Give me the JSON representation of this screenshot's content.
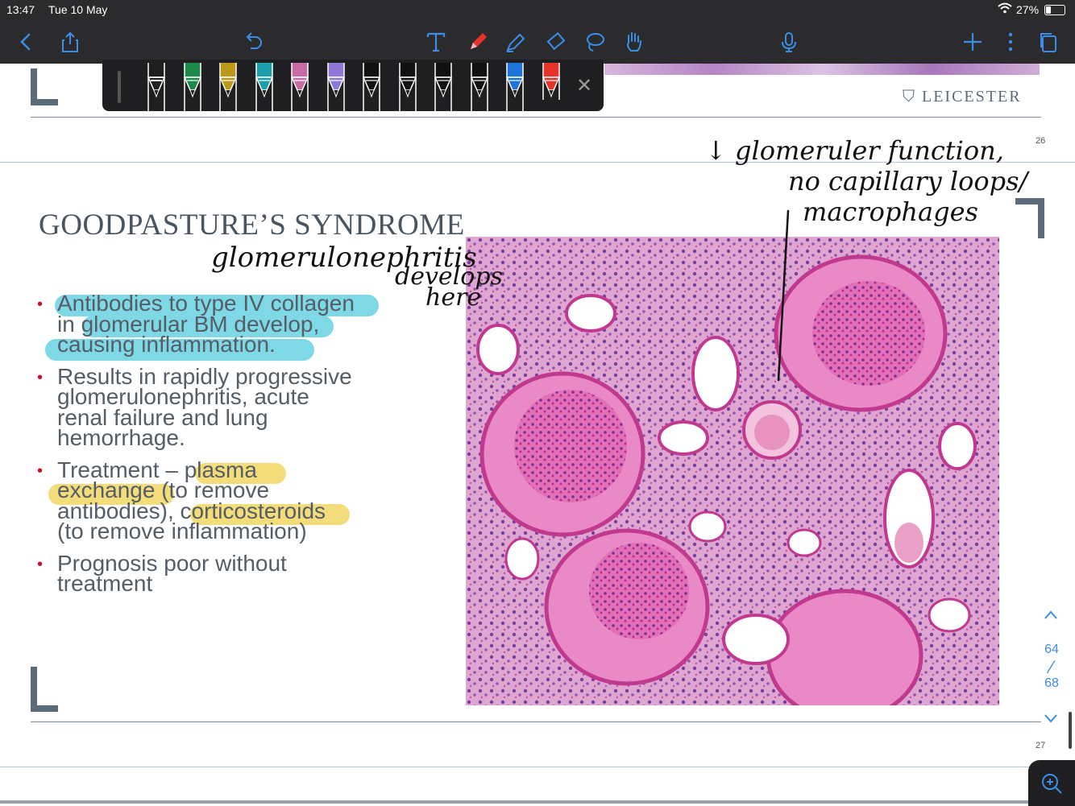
{
  "status_bar": {
    "time": "13:47",
    "date": "Tue 10 May",
    "battery": "27%"
  },
  "toolbar": {
    "left": [
      "back-icon",
      "share-icon"
    ],
    "center": [
      "undo-icon",
      "text-tool-icon",
      "pen-tool-icon",
      "highlighter-tool-icon",
      "eraser-tool-icon",
      "lasso-tool-icon",
      "hand-tool-icon"
    ],
    "right": [
      "microphone-icon",
      "add-page-icon",
      "more-icon",
      "pages-icon"
    ]
  },
  "pen_palette": {
    "colors": [
      "#ffffff",
      "#1e8a4a",
      "#b9981a",
      "#1aa0a8",
      "#c86aa6",
      "#8e78d8",
      "#111111",
      "#111111",
      "#111111",
      "#111111",
      "#1e73d8",
      "#e8332a"
    ],
    "close_label": "✕"
  },
  "slide_top": {
    "logo_text": "LEICESTER",
    "page_number": "26"
  },
  "slide": {
    "title": "GOODPASTURE’S SYNDROME",
    "bullets": [
      {
        "lines": [
          "Antibodies to type IV collagen",
          "in glomerular BM develop,",
          "causing inflammation."
        ]
      },
      {
        "lines": [
          "Results in rapidly progressive",
          "glomerulonephritis, acute",
          "renal failure and lung",
          "hemorrhage."
        ]
      },
      {
        "lines": [
          "Treatment – plasma",
          "exchange (to remove",
          "antibodies), corticosteroids",
          "(to remove inflammation)"
        ]
      },
      {
        "lines": [
          "Prognosis poor without",
          "treatment"
        ]
      }
    ],
    "page_number": "27",
    "highlight_colors": {
      "cyan": "#7fd8e6",
      "yellow": "#f3dc7a"
    }
  },
  "handwriting": {
    "left": [
      "glomerulonephritis",
      "develops",
      "here"
    ],
    "right": [
      "↓ glomeruler function,",
      "no capillary loops/",
      "macrophages"
    ]
  },
  "page_nav": {
    "current": "64",
    "total": "68",
    "separator": "⁄"
  },
  "zoom_button": "zoom-in-icon"
}
